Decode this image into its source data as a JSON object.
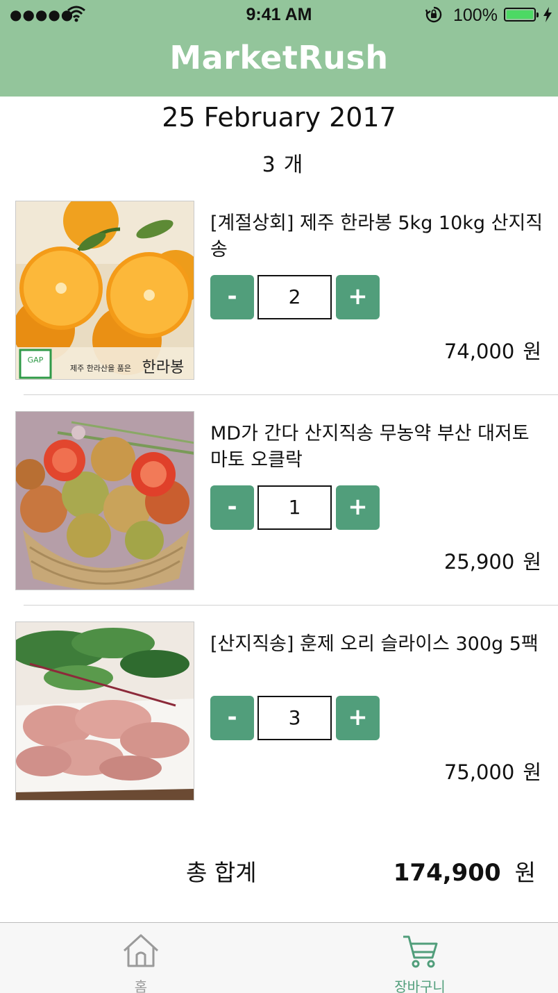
{
  "status_bar": {
    "signal_icon": "signal-dots-icon",
    "wifi_icon": "wifi-icon",
    "time": "9:41 AM",
    "rotation_lock_icon": "rotation-lock-icon",
    "battery_percent": "100%",
    "battery_level": 1.0,
    "charging_icon": "bolt-icon"
  },
  "header": {
    "title": "MarketRush",
    "background_color": "#93c59b"
  },
  "cart": {
    "date": "25 February 2017",
    "count_value": "3",
    "count_unit": "개",
    "items": [
      {
        "name": "[계절상회] 제주 한라봉 5kg 10kg 산지직송",
        "quantity": "2",
        "price": "74,000",
        "currency": "원",
        "image": "hallabong-oranges",
        "image_caption_prefix": "제주 한라산을 품은",
        "image_caption_main": "한라봉",
        "image_badge": "GAP"
      },
      {
        "name": "MD가 간다 산지직송 무농약 부산 대저토마토 오클락",
        "quantity": "1",
        "price": "25,900",
        "currency": "원",
        "image": "tomatoes-basket"
      },
      {
        "name": "[산지직송] 훈제 오리 슬라이스 300g 5팩",
        "quantity": "3",
        "price": "75,000",
        "currency": "원",
        "image": "smoked-duck-slices"
      }
    ],
    "minus_label": "-",
    "plus_label": "+",
    "button_color": "#519e7b",
    "total_label": "총 합계",
    "total_value": "174,900",
    "total_currency": "원"
  },
  "tabbar": {
    "tabs": [
      {
        "label": "홈",
        "icon": "home-icon",
        "active": false
      },
      {
        "label": "장바구니",
        "icon": "cart-icon",
        "active": true
      }
    ]
  }
}
